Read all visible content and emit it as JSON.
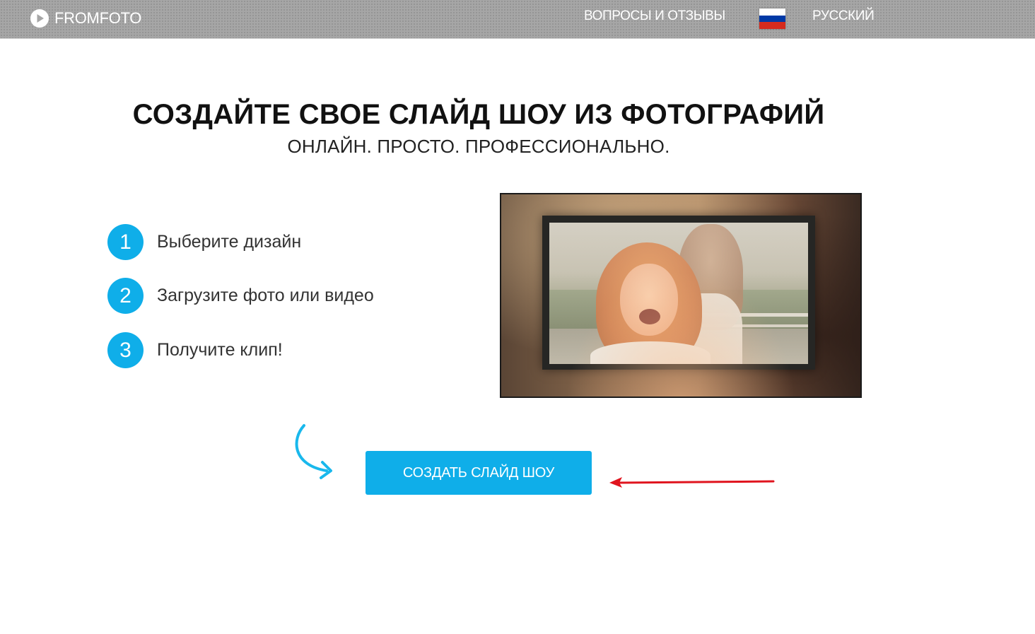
{
  "header": {
    "logo_text": "FROMFOTO",
    "logo_icon": "play-circle-icon",
    "nav_faq": "ВОПРОСЫ И ОТЗЫВЫ",
    "language": "РУССКИЙ",
    "flag_icon": "russia-flag-icon",
    "flag_colors": [
      "#ffffff",
      "#0039a6",
      "#d52b1e"
    ]
  },
  "hero": {
    "title": "СОЗДАЙТЕ СВОЕ СЛАЙД ШОУ ИЗ ФОТОГРАФИЙ",
    "subtitle": "ОНЛАЙН. ПРОСТО. ПРОФЕССИОНАЛЬНО."
  },
  "steps": [
    {
      "number": "1",
      "label": "Выберите дизайн"
    },
    {
      "number": "2",
      "label": "Загрузите фото или видео"
    },
    {
      "number": "3",
      "label": "Получите клип!"
    }
  ],
  "cta": {
    "label": "СОЗДАТЬ СЛАЙД ШОУ",
    "decor_arrow_icon": "curved-arrow-icon",
    "annotation_icon": "red-pointer-arrow-icon"
  },
  "colors": {
    "accent": "#0faee9",
    "header_bg": "#a6a6a6",
    "annotation": "#e0141e"
  }
}
